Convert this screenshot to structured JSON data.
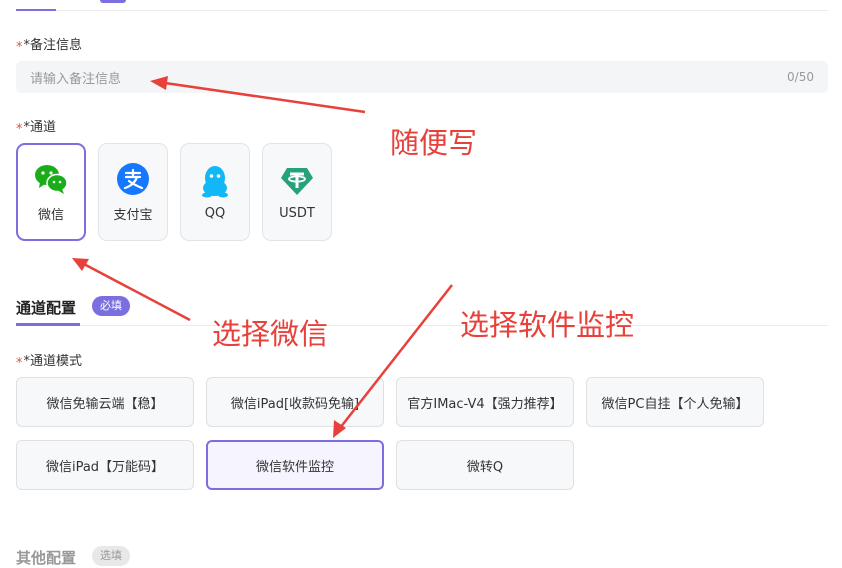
{
  "remark": {
    "label": "*备注信息",
    "placeholder": "请输入备注信息",
    "counter": "0/50"
  },
  "channel": {
    "label": "*通道",
    "items": [
      {
        "name": "微信",
        "icon": "wechat-icon",
        "selected": true
      },
      {
        "name": "支付宝",
        "icon": "alipay-icon",
        "selected": false
      },
      {
        "name": "QQ",
        "icon": "qq-icon",
        "selected": false
      },
      {
        "name": "USDT",
        "icon": "tether-icon",
        "selected": false
      }
    ]
  },
  "config_section": {
    "title": "通道配置",
    "badge": "必填"
  },
  "mode": {
    "label": "*通道模式",
    "options": [
      {
        "label": "微信免输云端【稳】",
        "selected": false
      },
      {
        "label": "微信iPad[收款码免输]",
        "selected": false
      },
      {
        "label": "官方IMac-V4【强力推荐】",
        "selected": false
      },
      {
        "label": "微信PC自挂【个人免输】",
        "selected": false
      },
      {
        "label": "微信iPad【万能码】",
        "selected": false
      },
      {
        "label": "微信软件监控",
        "selected": true
      },
      {
        "label": "微转Q",
        "selected": false
      }
    ]
  },
  "other_section": {
    "title": "其他配置",
    "badge": "选填"
  },
  "annotations": {
    "note1": "随便写",
    "note2": "选择微信",
    "note3": "选择软件监控"
  },
  "colors": {
    "accent": "#7b6ee0",
    "annotation": "#e8403a",
    "required_star": "#e84b4b",
    "wechat": "#1aad19",
    "alipay": "#1677ff",
    "qq": "#12b7f5",
    "tether": "#26a17b"
  }
}
